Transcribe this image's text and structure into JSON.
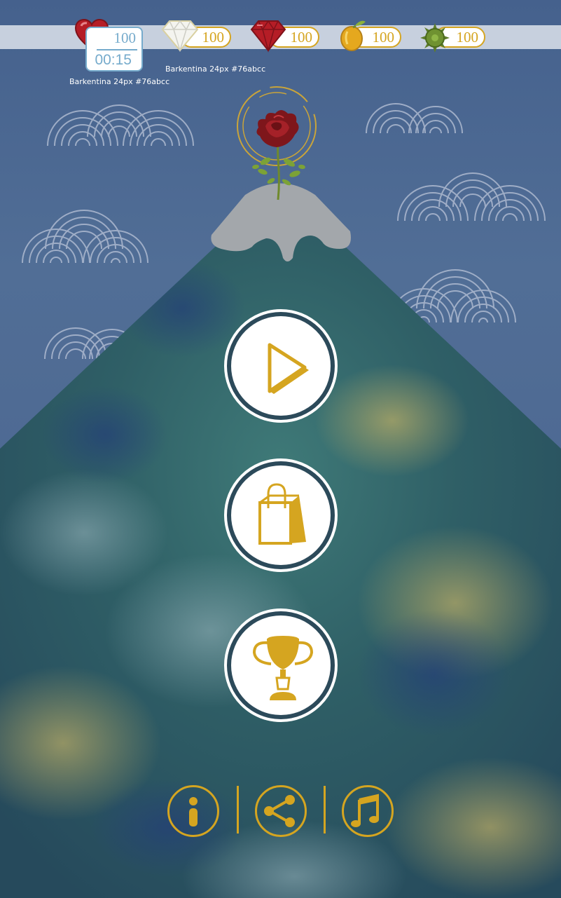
{
  "header": {
    "lives": {
      "count": "100",
      "timer": "00:15",
      "icon": "heart-icon",
      "color": "#76abcc"
    },
    "resources": [
      {
        "name": "diamond",
        "icon": "diamond-icon",
        "value": "100"
      },
      {
        "name": "ruby",
        "icon": "ruby-icon",
        "value": "100"
      },
      {
        "name": "lemon",
        "icon": "lemon-icon",
        "value": "100"
      },
      {
        "name": "spiky-ball",
        "icon": "spiky-ball-icon",
        "value": "100"
      }
    ],
    "notes": [
      "Barkentina 24px #76abcc",
      "Barkentina 24px #76abcc"
    ]
  },
  "emblem": {
    "icon": "rose-icon"
  },
  "menu": [
    {
      "name": "play-button",
      "icon": "play-icon"
    },
    {
      "name": "shop-button",
      "icon": "shopping-bag-icon"
    },
    {
      "name": "leaderboard-button",
      "icon": "trophy-icon"
    }
  ],
  "footer": [
    {
      "name": "info-button",
      "icon": "info-icon"
    },
    {
      "name": "share-button",
      "icon": "share-icon"
    },
    {
      "name": "music-button",
      "icon": "music-note-icon"
    }
  ],
  "colors": {
    "gold": "#d5a520",
    "sky": "#4b6288",
    "strip": "#c7d0de",
    "mountain_dark": "#2c4a5a",
    "snow": "#a3a7ab",
    "rose": "#8c1a1e",
    "heart": "#b51d26",
    "label_blue": "#76abcc"
  }
}
